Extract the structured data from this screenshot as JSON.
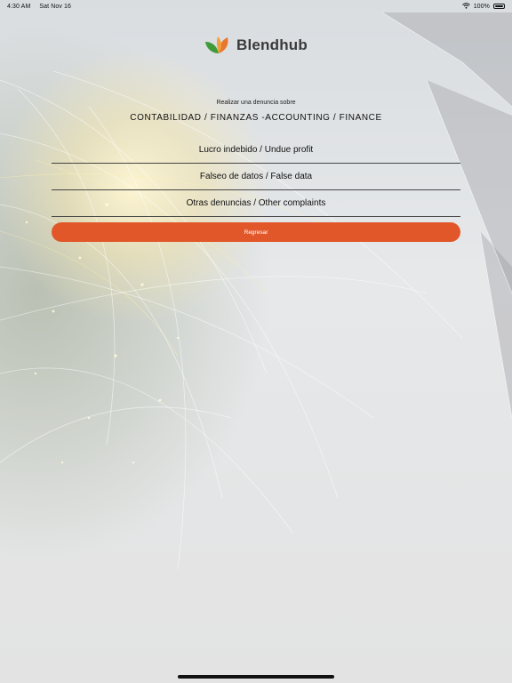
{
  "status_bar": {
    "time": "4:30 AM",
    "date": "Sat Nov 16",
    "battery": "100%",
    "battery_level": 1.0,
    "wifi_icon": "wifi-icon",
    "battery_icon": "battery-icon"
  },
  "header": {
    "logo_text": "Blendhub",
    "logo_icon": "leaf-logo-icon"
  },
  "report": {
    "subtitle": "Realizar una denuncia sobre",
    "category": "CONTABILIDAD / FINANZAS -ACCOUNTING / FINANCE"
  },
  "options": [
    {
      "label": "Lucro indebido / Undue profit"
    },
    {
      "label": "Falseo de datos / False data"
    },
    {
      "label": "Otras denuncias / Other complaints"
    }
  ],
  "back_button": {
    "label": "Regresar"
  },
  "colors": {
    "accent": "#e2572a",
    "logo_green": "#3f9b3a",
    "logo_orange": "#e8772e",
    "text": "#111111"
  }
}
